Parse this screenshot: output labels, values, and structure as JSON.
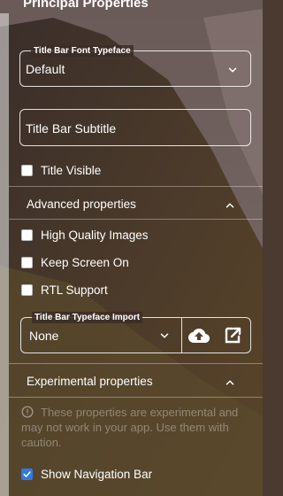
{
  "panel": {
    "title": "Principal Properties"
  },
  "title_font": {
    "legend": "Title Bar Font Typeface",
    "value": "Default"
  },
  "subtitle": {
    "value": "Title Bar Subtitle"
  },
  "title_visible": {
    "label": "Title Visible",
    "checked": false
  },
  "advanced": {
    "header": "Advanced properties",
    "items": [
      {
        "label": "High Quality Images",
        "checked": false
      },
      {
        "label": "Keep Screen On",
        "checked": false
      },
      {
        "label": "RTL Support",
        "checked": false
      }
    ],
    "typeface_import": {
      "legend": "Title Bar Typeface Import",
      "value": "None"
    }
  },
  "experimental": {
    "header": "Experimental properties",
    "note": "These properties are experimental and may not work in your app. Use them with caution.",
    "show_nav": {
      "label": "Show Navigation Bar",
      "checked": true
    }
  },
  "icons": {
    "dropdown": "chevron-down-icon",
    "collapse": "chevron-up-icon",
    "upload": "cloud-upload-icon",
    "open": "open-external-icon",
    "info": "info-icon"
  }
}
